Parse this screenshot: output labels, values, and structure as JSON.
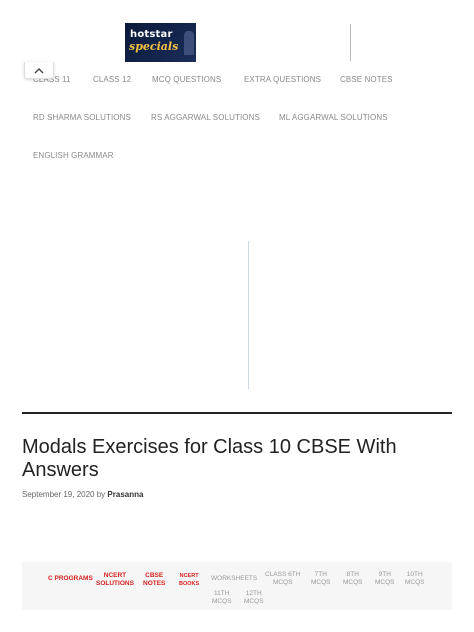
{
  "ad": {
    "brand": "hotstar",
    "sub": "specials"
  },
  "top_nav": [
    "CLASS 11",
    "CLASS 12",
    "MCQ QUESTIONS",
    "EXTRA QUESTIONS",
    "CBSE NOTES",
    "RD SHARMA SOLUTIONS",
    "RS AGGARWAL SOLUTIONS",
    "ML AGGARWAL SOLUTIONS",
    "ENGLISH GRAMMAR"
  ],
  "post": {
    "title": "Modals Exercises for Class 10 CBSE With Answers",
    "date": "September 19, 2020",
    "by": "by",
    "author": "Prasanna"
  },
  "bottom_nav": [
    {
      "line1": "C PROGRAMS",
      "line2": ""
    },
    {
      "line1": "NCERT",
      "line2": "SOLUTIONS"
    },
    {
      "line1": "CBSE",
      "line2": "NOTES"
    },
    {
      "line1": "NCERT",
      "line2": "BOOKS"
    },
    {
      "line1": "WORKSHEETS",
      "line2": ""
    },
    {
      "line1": "CLASS 6TH",
      "line2": "MCQS"
    },
    {
      "line1": "7TH",
      "line2": "MCQS"
    },
    {
      "line1": "8TH",
      "line2": "MCQS"
    },
    {
      "line1": "9TH",
      "line2": "MCQS"
    },
    {
      "line1": "10TH",
      "line2": "MCQS"
    },
    {
      "line1": "11TH",
      "line2": "MCQS"
    },
    {
      "line1": "12TH",
      "line2": "MCQS"
    }
  ],
  "colors": {
    "accent": "#d61f1f",
    "nav_text": "#8a8a8a",
    "rule": "#222222"
  }
}
